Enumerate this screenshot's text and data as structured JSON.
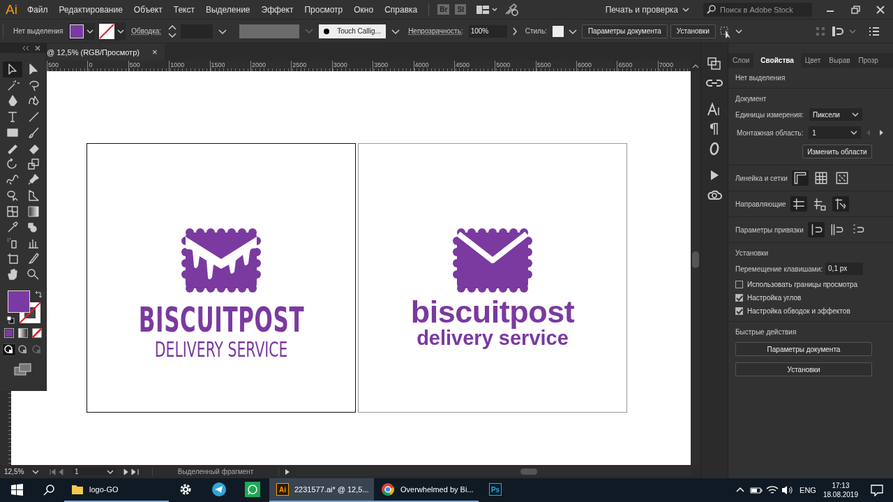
{
  "app": {
    "logo": "Ai"
  },
  "menu": [
    "Файл",
    "Редактирование",
    "Объект",
    "Текст",
    "Выделение",
    "Эффект",
    "Просмотр",
    "Окно",
    "Справка"
  ],
  "bridges": [
    "Br",
    "St"
  ],
  "workspace": "Печать и проверка",
  "stock_search": {
    "placeholder": "Поиск в Adobe Stock"
  },
  "control_bar": {
    "selection": "Нет выделения",
    "stroke_label": "Обводка:",
    "brush": "Touch Callig...",
    "opacity_label": "Непрозрачность:",
    "opacity": "100%",
    "style_label": "Стиль:",
    "buttons": [
      "Параметры документа",
      "Установки"
    ]
  },
  "document_tab": {
    "title": "@ 12,5% (RGB/Просмотр)",
    "close": "×"
  },
  "ruler": [
    "500",
    "0",
    "500",
    "1000",
    "1500",
    "2000",
    "2500",
    "3000",
    "3500",
    "4000",
    "4500",
    "5000",
    "5500",
    "6000",
    "6500",
    "7000"
  ],
  "tools": [
    {
      "selected": true
    },
    {
      "selected": false
    },
    {
      "selected": false
    },
    {
      "selected": false
    },
    {
      "selected": false
    },
    {
      "selected": false
    },
    {
      "selected": false
    },
    {
      "selected": false
    },
    {
      "selected": false
    },
    {
      "selected": false
    },
    {
      "selected": false
    },
    {
      "selected": false
    },
    {
      "selected": false
    },
    {
      "selected": false
    },
    {
      "selected": false
    },
    {
      "selected": false
    },
    {
      "selected": false
    },
    {
      "selected": false
    },
    {
      "selected": false
    },
    {
      "selected": false
    },
    {
      "selected": false
    },
    {
      "selected": false
    },
    {
      "selected": false
    },
    {
      "selected": false
    },
    {
      "selected": false
    },
    {
      "selected": false
    },
    {
      "selected": false
    },
    {
      "selected": false
    }
  ],
  "draw_modes": [
    {
      "selected": true
    },
    {
      "selected": false
    },
    {
      "selected": false
    }
  ],
  "artboards": [
    {
      "kind": "stencil",
      "selected": true,
      "name": "BISCUITPOST",
      "tagline": "DELIVERY SERVICE"
    },
    {
      "kind": "rounded",
      "selected": false,
      "name": "biscuitpost",
      "tagline": "delivery service"
    }
  ],
  "panel": {
    "tabs": [
      {
        "label": "Слои",
        "selected": false
      },
      {
        "label": "Свойства",
        "selected": true
      },
      {
        "label": "Цвет",
        "selected": false
      },
      {
        "label": "Вырав",
        "selected": false
      },
      {
        "label": "Прозр",
        "selected": false
      }
    ],
    "selection": "Нет выделения",
    "document": {
      "heading": "Документ",
      "units_label": "Единицы измерения:",
      "units": "Пиксели",
      "artboard_label": "Монтажная область:",
      "artboard": "1",
      "edit_button": "Изменить области"
    },
    "toggle_rows": [
      {
        "label": "Линейка и сетки",
        "buttons": [
          {
            "selected": true
          },
          {
            "selected": false
          },
          {
            "selected": false
          }
        ]
      },
      {
        "label": "Направляющие",
        "buttons": [
          {
            "selected": true
          },
          {
            "selected": false
          },
          {
            "selected": true
          }
        ]
      },
      {
        "label": "Параметры привязки",
        "buttons": [
          {
            "selected": true
          },
          {
            "selected": false
          },
          {
            "selected": false
          }
        ]
      }
    ],
    "settings": {
      "heading": "Установки",
      "nudge_label": "Перемещение клавишами:",
      "nudge": "0,1 px",
      "checks": [
        {
          "label": "Использовать границы просмотра",
          "checked": false
        },
        {
          "label": "Настройка углов",
          "checked": true
        },
        {
          "label": "Настройка обводок и эффектов",
          "checked": true
        }
      ]
    },
    "quick": {
      "heading": "Быстрые действия",
      "buttons": [
        "Параметры документа",
        "Установки"
      ]
    }
  },
  "status_bar": {
    "zoom": "12,5%",
    "artboard": "1",
    "info": "Выделенный фрагмент"
  },
  "taskbar": {
    "apps": [
      {
        "kind": "folder",
        "label": "logo-GO",
        "selected": false,
        "running": true
      },
      {
        "kind": "gear",
        "selected": false,
        "running": false
      },
      {
        "kind": "telegram",
        "selected": false,
        "running": false
      },
      {
        "kind": "whatsapp",
        "selected": false,
        "running": false
      },
      {
        "kind": "adobe",
        "badge": "Ai",
        "label": "2231577.ai* @ 12,5...",
        "selected": true,
        "running": true
      },
      {
        "kind": "chrome",
        "label": "Overwhelmed by Bi...",
        "selected": false,
        "running": true
      },
      {
        "kind": "adobe",
        "badge": "Ps",
        "selected": false,
        "running": false
      }
    ],
    "language": "ENG",
    "time": "17:13",
    "date": "18.08.2019"
  }
}
